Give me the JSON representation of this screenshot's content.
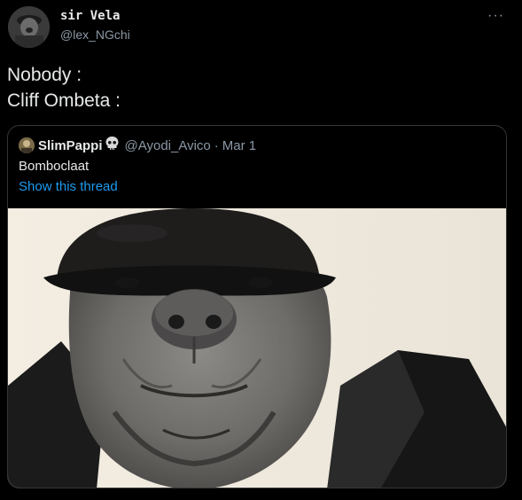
{
  "tweet": {
    "author": {
      "display_name": "sir Vela",
      "handle": "@lex_NGchi"
    },
    "more_icon": "more-horizontal-icon",
    "lines": [
      "Nobody :",
      "Cliff Ombeta :"
    ]
  },
  "quoted_tweet": {
    "display_name": "SlimPappi",
    "name_emoji": "skull",
    "handle": "@Ayodi_Avico",
    "separator": "·",
    "date": "Mar 1",
    "text": "Bomboclaat",
    "show_thread_label": "Show this thread"
  },
  "colors": {
    "background": "#000000",
    "text": "#e7e9ea",
    "muted": "#8b98a5",
    "link": "#1d9bf0",
    "border": "#333639"
  }
}
